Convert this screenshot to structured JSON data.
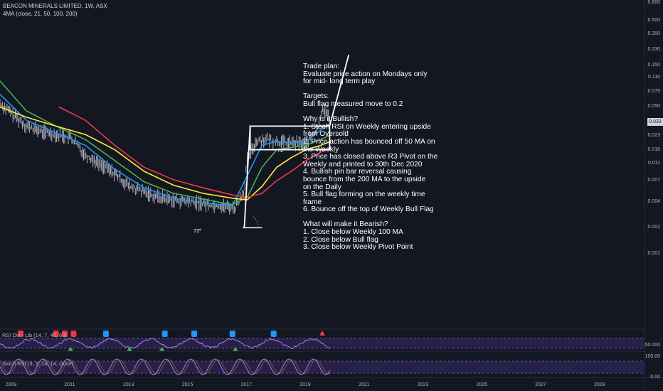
{
  "header": {
    "symbol_line": "BEACON MINERALS LIMITED, 1W, ASX",
    "indicator_line": "4MA (close, 21, 50, 100, 200)"
  },
  "price_axis": {
    "labels": [
      "0.800",
      "0.500",
      "0.350",
      "0.230",
      "0.150",
      "0.110",
      "0.075",
      "0.050",
      "0.033",
      "0.023",
      "0.016",
      "0.011",
      "0.007",
      "0.004",
      "0.002",
      "0.001"
    ],
    "current_price": "0.033"
  },
  "time_axis": {
    "years": [
      "2009",
      "2011",
      "2013",
      "2015",
      "2017",
      "2019",
      "2021",
      "2023",
      "2025",
      "2027",
      "2029"
    ]
  },
  "annotations": {
    "angle_upper": "72º",
    "angle_lower": "72º"
  },
  "trade_plan": {
    "text": "Trade plan:\nEvaluate price action on Mondays only\nfor mid- long term play\n\nTargets:\nBull flag measured move to 0.2\n\nWhy is it Bullish?\n1. Stoch RSI on Weekly entering upside\nfrom Oversold\n2. Price action has bounced off 50 MA on\nthe Weekly\n3. Price has closed above R3 Pivot on the\nWeekly and printed to 30th Dec 2020\n4. Bullish pin bar reversal causing\nbounce from the 200 MA to the upside\non the Daily\n5. Bull flag forming on the weekly time\nframe\n6. Bounce off the top of Weekly Bull Flag\n\nWhat will make it Bearish?\n1. Close below Weekly 100 MA\n2. Close below Bull flag\n3. Close below Weekly Pivot Point"
  },
  "rsi_panel": {
    "label": "RSI Div - Lib (14, 7, 40, 60)",
    "axis_value": "50.000"
  },
  "stoch_panel": {
    "label": "Stoch RSI (3, 3, 14, 14, close)",
    "axis_top": "100.00",
    "axis_bottom": "0.00"
  },
  "colors": {
    "background": "#131722",
    "ma21": "#2196f3",
    "ma50": "#4caf50",
    "ma100": "#ffeb3b",
    "ma200": "#f23645",
    "rsi_band": "#3b2a66",
    "stoch_band": "#3b2a66",
    "rsi_bull_marker": "#2196f3",
    "rsi_bear_marker": "#f23645",
    "rsi_hidden_marker": "#4caf50"
  },
  "chart_data": {
    "type": "line",
    "title": "BEACON MINERALS LIMITED, 1W, ASX",
    "y_scale": "log",
    "ylim": [
      0.001,
      0.8
    ],
    "xlim": [
      2008.6,
      2030.5
    ],
    "series": [
      {
        "name": "Price",
        "x": [
          2008.6,
          2009,
          2009.5,
          2010,
          2010.5,
          2011,
          2011.5,
          2012,
          2012.5,
          2013,
          2013.5,
          2014,
          2014.5,
          2015,
          2015.5,
          2016,
          2016.3,
          2016.6,
          2016.9,
          2017,
          2017.3,
          2017.6,
          2018,
          2018.5,
          2019,
          2019.2,
          2019.4,
          2019.55,
          2019.7,
          2019.85
        ],
        "y": [
          0.055,
          0.042,
          0.03,
          0.026,
          0.024,
          0.022,
          0.014,
          0.011,
          0.0085,
          0.006,
          0.0052,
          0.0045,
          0.0042,
          0.004,
          0.0038,
          0.0036,
          0.0035,
          0.0034,
          0.0055,
          0.012,
          0.02,
          0.021,
          0.02,
          0.019,
          0.019,
          0.023,
          0.028,
          0.05,
          0.042,
          0.033
        ]
      },
      {
        "name": "MA 21",
        "x": [
          2008.6,
          2009.5,
          2010.5,
          2011.5,
          2012.5,
          2013.5,
          2014.5,
          2015.5,
          2016.5,
          2017,
          2017.5,
          2018,
          2018.5,
          2019,
          2019.5,
          2019.85
        ],
        "y": [
          0.07,
          0.035,
          0.025,
          0.018,
          0.0095,
          0.0058,
          0.0044,
          0.0039,
          0.0036,
          0.008,
          0.018,
          0.02,
          0.019,
          0.02,
          0.027,
          0.033
        ]
      },
      {
        "name": "MA 50",
        "x": [
          2008.6,
          2009.5,
          2010.5,
          2011.5,
          2012.5,
          2013.5,
          2014.5,
          2015.5,
          2016.5,
          2017,
          2017.5,
          2018,
          2018.5,
          2019,
          2019.5,
          2019.85
        ],
        "y": [
          0.1,
          0.045,
          0.03,
          0.021,
          0.012,
          0.0068,
          0.005,
          0.0043,
          0.0037,
          0.0045,
          0.01,
          0.016,
          0.017,
          0.018,
          0.021,
          0.024
        ]
      },
      {
        "name": "MA 100",
        "x": [
          2008.6,
          2009.5,
          2010.5,
          2011.5,
          2012.5,
          2013.5,
          2014.5,
          2015.5,
          2016.5,
          2017,
          2017.5,
          2018,
          2018.5,
          2019,
          2019.5,
          2019.85
        ],
        "y": [
          0.05,
          0.038,
          0.03,
          0.024,
          0.016,
          0.009,
          0.0062,
          0.005,
          0.0044,
          0.0042,
          0.006,
          0.01,
          0.013,
          0.016,
          0.018,
          0.02
        ]
      },
      {
        "name": "MA 200",
        "x": [
          2010.6,
          2011.5,
          2012.5,
          2013.5,
          2014.5,
          2015.5,
          2016.5,
          2017,
          2017.5,
          2018,
          2018.5,
          2019,
          2019.5,
          2019.85
        ],
        "y": [
          0.05,
          0.035,
          0.018,
          0.01,
          0.0072,
          0.0058,
          0.0048,
          0.0045,
          0.005,
          0.007,
          0.009,
          0.012,
          0.015,
          0.017
        ]
      }
    ],
    "drawings": {
      "flag_box": {
        "x": [
          2017.1,
          2019.8
        ],
        "y": [
          0.016,
          0.03
        ]
      },
      "pole_left": {
        "x": [
          2016.9,
          2017.1
        ],
        "y": [
          0.002,
          0.03
        ]
      },
      "target_line": {
        "x": [
          2019.8,
          2020.45
        ],
        "y": [
          0.03,
          0.2
        ]
      }
    }
  }
}
